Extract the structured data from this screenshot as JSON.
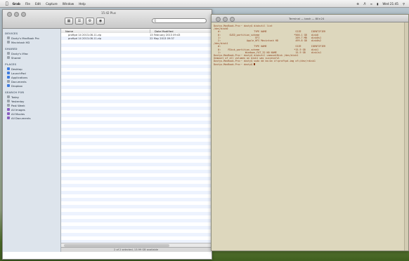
{
  "menubar": {
    "items": [
      "Grab",
      "File",
      "Edit",
      "Capture",
      "Window",
      "Help"
    ],
    "clock": "Wed 21:45"
  },
  "finder": {
    "title": "15:42 Plus",
    "search_placeholder": "Q",
    "sidebar": {
      "sections": [
        {
          "heading": "DEVICES",
          "items": [
            {
              "label": "Dusty's MacBook Pro",
              "icon": "laptop-icon"
            },
            {
              "label": "Macintosh HD",
              "icon": "drive-icon"
            }
          ]
        },
        {
          "heading": "SHARED",
          "items": [
            {
              "label": "Dusty's iMac",
              "icon": "computer-icon"
            },
            {
              "label": "Shared",
              "icon": "network-icon"
            }
          ]
        },
        {
          "heading": "PLACES",
          "items": [
            {
              "label": "Desktop",
              "icon": "desktop-icon"
            },
            {
              "label": "LaunchPad",
              "icon": "home-icon"
            },
            {
              "label": "Applications",
              "icon": "applications-icon"
            },
            {
              "label": "Documents",
              "icon": "documents-icon"
            },
            {
              "label": "Dropbox",
              "icon": "dropbox-icon"
            }
          ]
        },
        {
          "heading": "SEARCH FOR",
          "items": [
            {
              "label": "Today",
              "icon": "clock-icon"
            },
            {
              "label": "Yesterday",
              "icon": "clock-icon"
            },
            {
              "label": "Past Week",
              "icon": "clock-icon"
            },
            {
              "label": "All Images",
              "icon": "images-icon"
            },
            {
              "label": "All Movies",
              "icon": "movies-icon"
            },
            {
              "label": "All Documents",
              "icon": "documents-icon"
            }
          ]
        }
      ]
    },
    "columns": {
      "name": "Name",
      "date": "Date Modified"
    },
    "files": [
      {
        "name": "proftpd 14 2013-08-11.zip",
        "date": "13 February 2013 09:43"
      },
      {
        "name": "proftpd 14 2013-08-11.zip",
        "date": "22 May 2013 09:37"
      }
    ],
    "status": "2 of 2 selected, 13.99 GB available"
  },
  "terminal": {
    "title": "Terminal — bash — 80×24",
    "lines": [
      "Dustys-MacBook-Pro:~ dusty$ diskutil list",
      "/dev/disk0",
      "   #:                       TYPE NAME                    SIZE       IDENTIFIER",
      "   0:      GUID_partition_scheme                        *500.1 GB   disk0",
      "   1:                        EFI                         209.7 MB   disk0s1",
      "   2:                  Apple_HFS Macintosh HD            499.8 GB   disk0s2",
      "/dev/disk1",
      "   #:                       TYPE NAME                    SIZE       IDENTIFIER",
      "   0:     FDisk_partition_scheme                        *15.9 GB    disk1",
      "   1:                 Windows_FAT_32 NO NAME             15.9 GB    disk1s1",
      "Dustys-MacBook-Pro:~ dusty$ diskutil unmountDisk /dev/disk1",
      "Unmount of all volumes on disk1 was successful",
      "Dustys-MacBook-Pro:~ dusty$ sudo dd bs=1m if=proftpd.img of=/dev/rdisk1",
      "Dustys-MacBook-Pro:~ dusty$ "
    ]
  }
}
